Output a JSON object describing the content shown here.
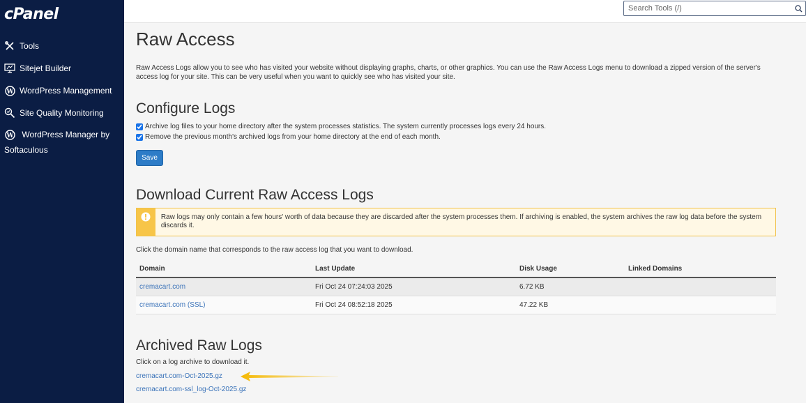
{
  "app": {
    "logo": "cPanel"
  },
  "sidebar": {
    "items": [
      {
        "label": "Tools",
        "icon": "tools-icon"
      },
      {
        "label": "Sitejet Builder",
        "icon": "sitejet-icon"
      },
      {
        "label": "WordPress Management",
        "icon": "wordpress-icon"
      },
      {
        "label": "Site Quality Monitoring",
        "icon": "site-quality-icon"
      },
      {
        "label": "WordPress Manager by Softaculous",
        "icon": "wordpress-icon"
      }
    ]
  },
  "search": {
    "placeholder": "Search Tools (/)"
  },
  "page": {
    "title": "Raw Access",
    "description": "Raw Access Logs allow you to see who has visited your website without displaying graphs, charts, or other graphics. You can use the Raw Access Logs menu to download a zipped version of the server's access log for your site. This can be very useful when you want to quickly see who has visited your site."
  },
  "configure": {
    "heading": "Configure Logs",
    "archive_label": "Archive log files to your home directory after the system processes statistics. The system currently processes logs every 24 hours.",
    "archive_checked": true,
    "remove_label": "Remove the previous month's archived logs from your home directory at the end of each month.",
    "remove_checked": true,
    "save_label": "Save"
  },
  "download": {
    "heading": "Download Current Raw Access Logs",
    "warning": "Raw logs may only contain a few hours' worth of data because they are discarded after the system processes them. If archiving is enabled, the system archives the raw log data before the system discards it.",
    "help": "Click the domain name that corresponds to the raw access log that you want to download.",
    "columns": [
      "Domain",
      "Last Update",
      "Disk Usage",
      "Linked Domains"
    ],
    "rows": [
      {
        "domain": "cremacart.com",
        "last_update": "Fri Oct 24 07:24:03 2025",
        "disk_usage": "6.72 KB",
        "linked": ""
      },
      {
        "domain": "cremacart.com (SSL)",
        "last_update": "Fri Oct 24 08:52:18 2025",
        "disk_usage": "47.22 KB",
        "linked": ""
      }
    ]
  },
  "archived": {
    "heading": "Archived Raw Logs",
    "help": "Click on a log archive to download it.",
    "files": [
      "cremacart.com-Oct-2025.gz",
      "cremacart.com-ssl_log-Oct-2025.gz"
    ]
  },
  "colors": {
    "sidebar_bg": "#0b1d44",
    "link": "#3b73b9",
    "button": "#2d7cc7",
    "warning_accent": "#f7c548",
    "arrow": "#f5b800"
  }
}
